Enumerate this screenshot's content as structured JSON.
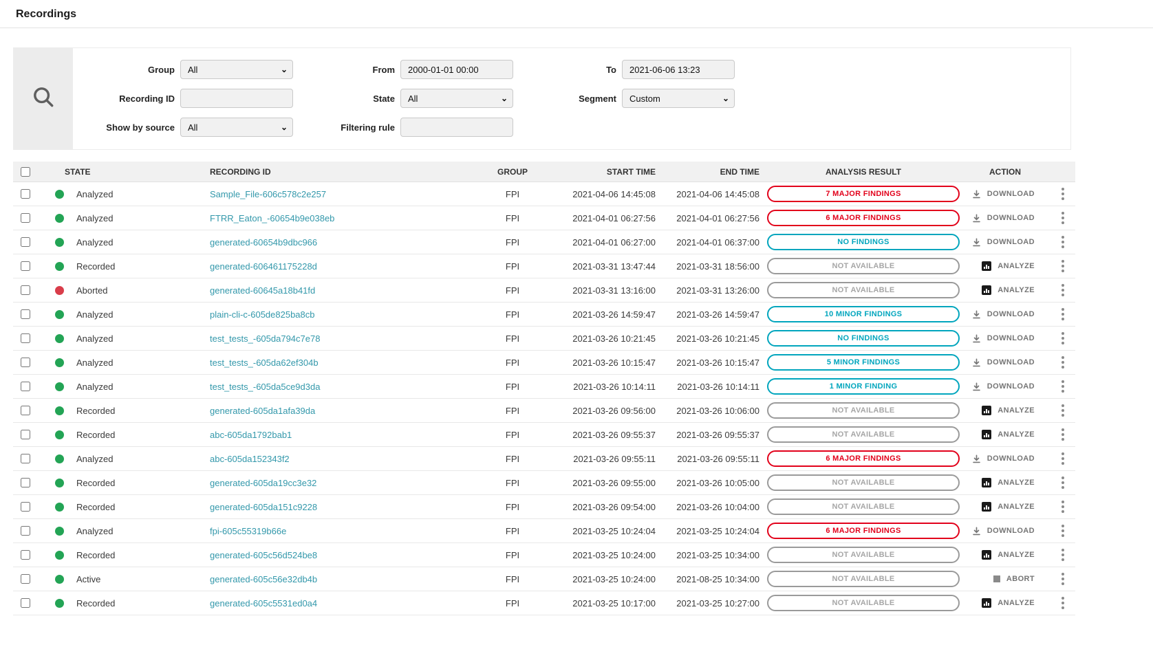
{
  "page": {
    "title": "Recordings"
  },
  "colors": {
    "link": "#3398ab",
    "state_green": "#23a455",
    "state_red": "#d93d4a",
    "pill_major": "#e2001a",
    "pill_minor": "#00a5bd",
    "action_text": "#757575"
  },
  "filters": {
    "group": {
      "label": "Group",
      "value": "All"
    },
    "recording_id": {
      "label": "Recording ID",
      "value": ""
    },
    "show_by_source": {
      "label": "Show by source",
      "value": "All"
    },
    "from": {
      "label": "From",
      "value": "2000-01-01 00:00"
    },
    "state": {
      "label": "State",
      "value": "All"
    },
    "filtering_rule": {
      "label": "Filtering rule",
      "value": ""
    },
    "to": {
      "label": "To",
      "value": "2021-06-06 13:23"
    },
    "segment": {
      "label": "Segment",
      "value": "Custom"
    }
  },
  "table": {
    "headers": [
      "STATE",
      "RECORDING ID",
      "GROUP",
      "START TIME",
      "END TIME",
      "ANALYSIS RESULT",
      "ACTION"
    ],
    "rows": [
      {
        "state": "Analyzed",
        "dot": "green",
        "id": "Sample_File-606c578c2e257",
        "group": "FPI",
        "start": "2021-04-06 14:45:08",
        "end": "2021-04-06 14:45:08",
        "result": "7 MAJOR FINDINGS",
        "result_type": "major",
        "action": "DOWNLOAD",
        "action_type": "download"
      },
      {
        "state": "Analyzed",
        "dot": "green",
        "id": "FTRR_Eaton_-60654b9e038eb",
        "group": "FPI",
        "start": "2021-04-01 06:27:56",
        "end": "2021-04-01 06:27:56",
        "result": "6 MAJOR FINDINGS",
        "result_type": "major",
        "action": "DOWNLOAD",
        "action_type": "download"
      },
      {
        "state": "Analyzed",
        "dot": "green",
        "id": "generated-60654b9dbc966",
        "group": "FPI",
        "start": "2021-04-01 06:27:00",
        "end": "2021-04-01 06:37:00",
        "result": "NO FINDINGS",
        "result_type": "minor",
        "action": "DOWNLOAD",
        "action_type": "download"
      },
      {
        "state": "Recorded",
        "dot": "green",
        "id": "generated-606461175228d",
        "group": "FPI",
        "start": "2021-03-31 13:47:44",
        "end": "2021-03-31 18:56:00",
        "result": "NOT AVAILABLE",
        "result_type": "na",
        "action": "ANALYZE",
        "action_type": "analyze"
      },
      {
        "state": "Aborted",
        "dot": "red",
        "id": "generated-60645a18b41fd",
        "group": "FPI",
        "start": "2021-03-31 13:16:00",
        "end": "2021-03-31 13:26:00",
        "result": "NOT AVAILABLE",
        "result_type": "na",
        "action": "ANALYZE",
        "action_type": "analyze"
      },
      {
        "state": "Analyzed",
        "dot": "green",
        "id": "plain-cli-c-605de825ba8cb",
        "group": "FPI",
        "start": "2021-03-26 14:59:47",
        "end": "2021-03-26 14:59:47",
        "result": "10 MINOR FINDINGS",
        "result_type": "minor",
        "action": "DOWNLOAD",
        "action_type": "download"
      },
      {
        "state": "Analyzed",
        "dot": "green",
        "id": "test_tests_-605da794c7e78",
        "group": "FPI",
        "start": "2021-03-26 10:21:45",
        "end": "2021-03-26 10:21:45",
        "result": "NO FINDINGS",
        "result_type": "minor",
        "action": "DOWNLOAD",
        "action_type": "download"
      },
      {
        "state": "Analyzed",
        "dot": "green",
        "id": "test_tests_-605da62ef304b",
        "group": "FPI",
        "start": "2021-03-26 10:15:47",
        "end": "2021-03-26 10:15:47",
        "result": "5 MINOR FINDINGS",
        "result_type": "minor",
        "action": "DOWNLOAD",
        "action_type": "download"
      },
      {
        "state": "Analyzed",
        "dot": "green",
        "id": "test_tests_-605da5ce9d3da",
        "group": "FPI",
        "start": "2021-03-26 10:14:11",
        "end": "2021-03-26 10:14:11",
        "result": "1 MINOR FINDING",
        "result_type": "minor",
        "action": "DOWNLOAD",
        "action_type": "download"
      },
      {
        "state": "Recorded",
        "dot": "green",
        "id": "generated-605da1afa39da",
        "group": "FPI",
        "start": "2021-03-26 09:56:00",
        "end": "2021-03-26 10:06:00",
        "result": "NOT AVAILABLE",
        "result_type": "na",
        "action": "ANALYZE",
        "action_type": "analyze"
      },
      {
        "state": "Recorded",
        "dot": "green",
        "id": "abc-605da1792bab1",
        "group": "FPI",
        "start": "2021-03-26 09:55:37",
        "end": "2021-03-26 09:55:37",
        "result": "NOT AVAILABLE",
        "result_type": "na",
        "action": "ANALYZE",
        "action_type": "analyze"
      },
      {
        "state": "Analyzed",
        "dot": "green",
        "id": "abc-605da152343f2",
        "group": "FPI",
        "start": "2021-03-26 09:55:11",
        "end": "2021-03-26 09:55:11",
        "result": "6 MAJOR FINDINGS",
        "result_type": "major",
        "action": "DOWNLOAD",
        "action_type": "download"
      },
      {
        "state": "Recorded",
        "dot": "green",
        "id": "generated-605da19cc3e32",
        "group": "FPI",
        "start": "2021-03-26 09:55:00",
        "end": "2021-03-26 10:05:00",
        "result": "NOT AVAILABLE",
        "result_type": "na",
        "action": "ANALYZE",
        "action_type": "analyze"
      },
      {
        "state": "Recorded",
        "dot": "green",
        "id": "generated-605da151c9228",
        "group": "FPI",
        "start": "2021-03-26 09:54:00",
        "end": "2021-03-26 10:04:00",
        "result": "NOT AVAILABLE",
        "result_type": "na",
        "action": "ANALYZE",
        "action_type": "analyze"
      },
      {
        "state": "Analyzed",
        "dot": "green",
        "id": "fpi-605c55319b66e",
        "group": "FPI",
        "start": "2021-03-25 10:24:04",
        "end": "2021-03-25 10:24:04",
        "result": "6 MAJOR FINDINGS",
        "result_type": "major",
        "action": "DOWNLOAD",
        "action_type": "download"
      },
      {
        "state": "Recorded",
        "dot": "green",
        "id": "generated-605c56d524be8",
        "group": "FPI",
        "start": "2021-03-25 10:24:00",
        "end": "2021-03-25 10:34:00",
        "result": "NOT AVAILABLE",
        "result_type": "na",
        "action": "ANALYZE",
        "action_type": "analyze"
      },
      {
        "state": "Active",
        "dot": "green",
        "id": "generated-605c56e32db4b",
        "group": "FPI",
        "start": "2021-03-25 10:24:00",
        "end": "2021-08-25 10:34:00",
        "result": "NOT AVAILABLE",
        "result_type": "na",
        "action": "ABORT",
        "action_type": "abort"
      },
      {
        "state": "Recorded",
        "dot": "green",
        "id": "generated-605c5531ed0a4",
        "group": "FPI",
        "start": "2021-03-25 10:17:00",
        "end": "2021-03-25 10:27:00",
        "result": "NOT AVAILABLE",
        "result_type": "na",
        "action": "ANALYZE",
        "action_type": "analyze"
      }
    ]
  }
}
